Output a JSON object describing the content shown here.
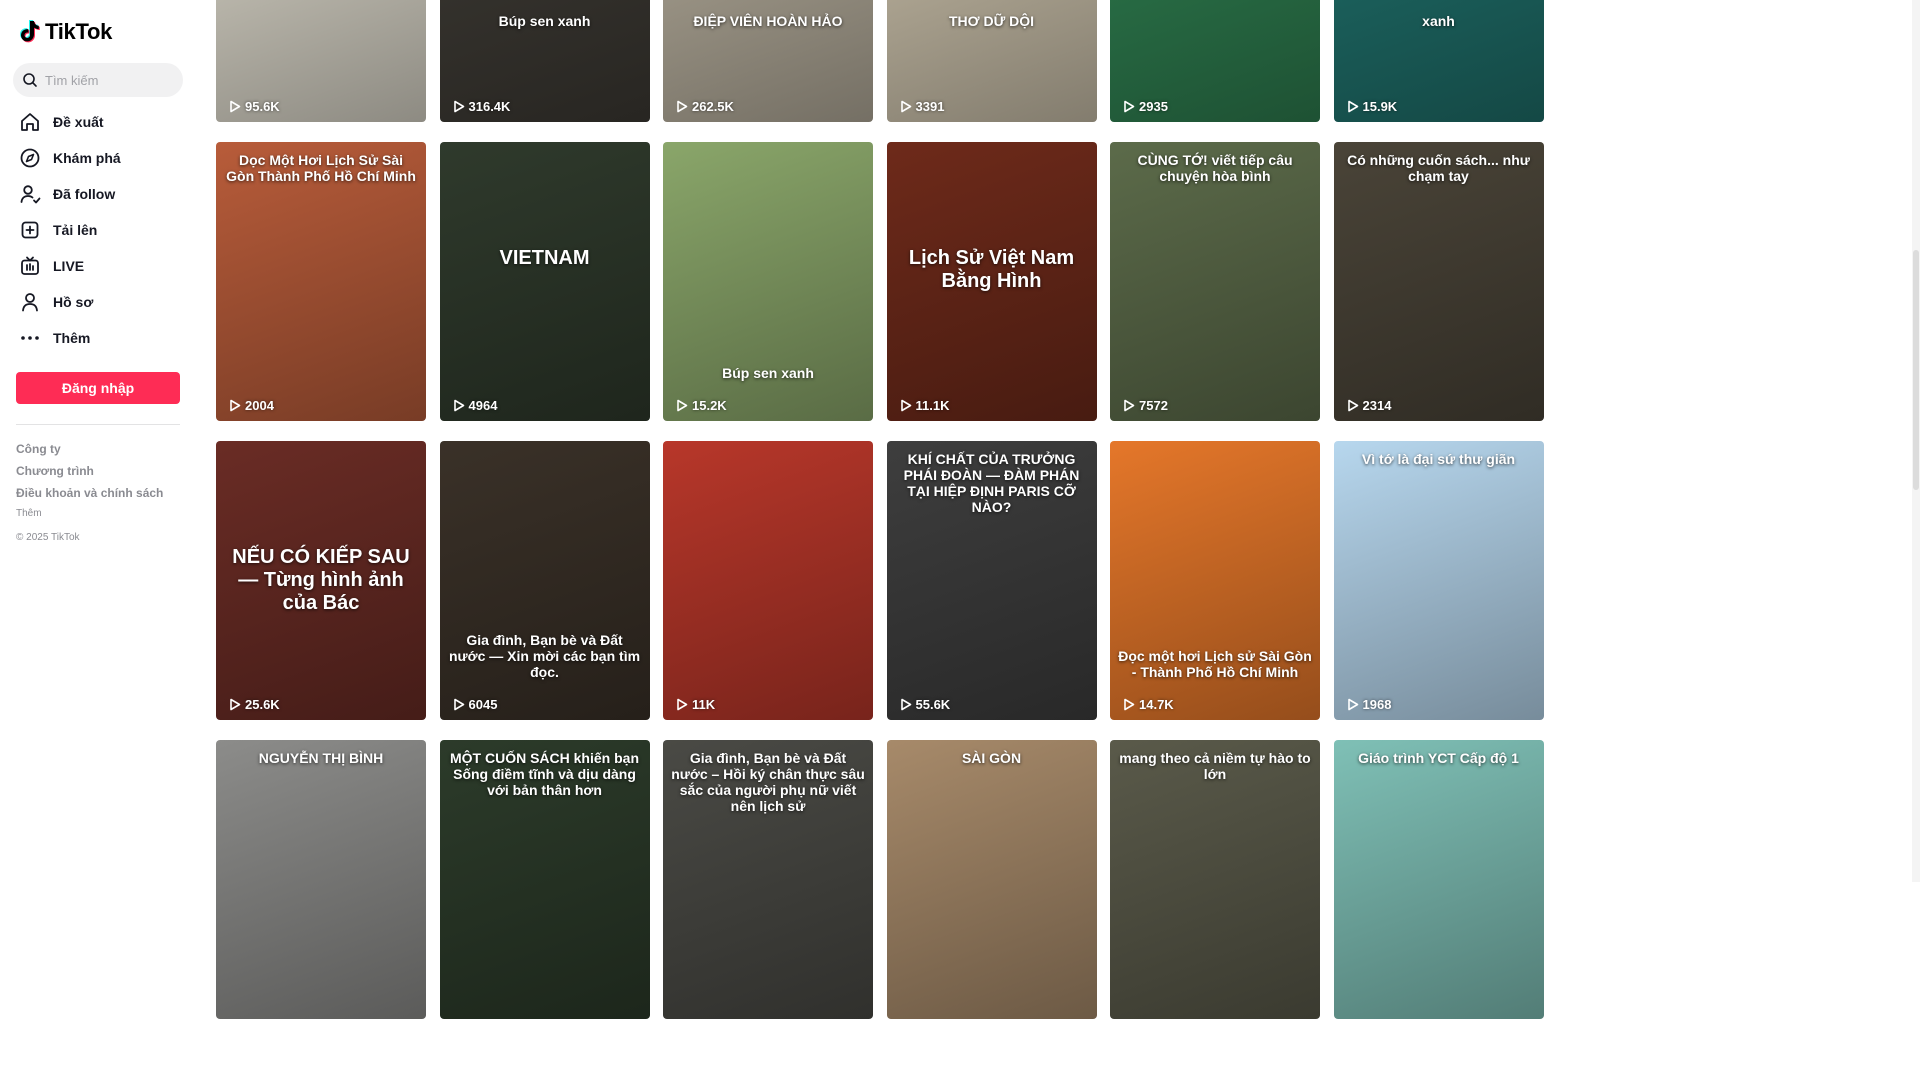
{
  "app": {
    "name": "TikTok"
  },
  "search": {
    "placeholder": "Tìm kiếm"
  },
  "nav": [
    {
      "label": "Đề xuất",
      "icon": "home-icon"
    },
    {
      "label": "Khám phá",
      "icon": "compass-icon"
    },
    {
      "label": "Đã follow",
      "icon": "following-icon"
    },
    {
      "label": "Tải lên",
      "icon": "upload-icon"
    },
    {
      "label": "LIVE",
      "icon": "live-icon"
    },
    {
      "label": "Hồ sơ",
      "icon": "profile-icon"
    },
    {
      "label": "Thêm",
      "icon": "more-icon"
    }
  ],
  "login_label": "Đăng nhập",
  "footer": {
    "links": [
      "Công ty",
      "Chương trình",
      "Điều khoản và chính sách"
    ],
    "more": "Thêm",
    "copyright": "© 2025 TikTok"
  },
  "videos": [
    {
      "views": "95.6K",
      "bg": "#d9d5c8",
      "caption": ""
    },
    {
      "views": "316.4K",
      "bg": "#3d3a34",
      "caption": "Búp sen xanh"
    },
    {
      "views": "262.5K",
      "bg": "#b3ab9a",
      "caption": "ĐIỆP VIÊN HOÀN HẢO"
    },
    {
      "views": "3391",
      "bg": "#c9bfa9",
      "caption": "THƠ DỮ DỘI"
    },
    {
      "views": "2935",
      "bg": "#2e7d4f",
      "caption": ""
    },
    {
      "views": "15.9K",
      "bg": "#1f6f6a",
      "caption": "xanh"
    },
    {
      "views": "2004",
      "bg": "#b85c3a",
      "caption": "Dọc Một Hơi Lịch Sử Sài Gòn Thành Phố Hồ Chí Minh"
    },
    {
      "views": "4964",
      "bg": "#2f3a2c",
      "caption": "VIETNAM"
    },
    {
      "views": "15.2K",
      "bg": "#8aa66a",
      "caption": "Búp sen xanh"
    },
    {
      "views": "11.1K",
      "bg": "#6e2a1a",
      "caption": "Lịch Sử Việt Nam Bằng Hình"
    },
    {
      "views": "7572",
      "bg": "#5c6b4a",
      "caption": "CÙNG TỚ! viết tiếp câu chuyện hòa bình"
    },
    {
      "views": "2314",
      "bg": "#4a4438",
      "caption": "Có những cuốn sách... như chạm tay"
    },
    {
      "views": "25.6K",
      "bg": "#6a2c25",
      "caption": "NẾU CÓ KIẾP SAU — Từng hình ảnh của Bác"
    },
    {
      "views": "6045",
      "bg": "#3a3128",
      "caption": "Gia đình, Bạn bè và Đất nước — Xin mời các bạn tìm đọc."
    },
    {
      "views": "11K",
      "bg": "#b8372a",
      "caption": ""
    },
    {
      "views": "55.6K",
      "bg": "#3e3e3e",
      "caption": "KHÍ CHẤT CỦA TRƯỞNG PHÁI ĐOÀN — ĐÀM PHÁN TẠI HIỆP ĐỊNH PARIS CỠ NÀO?"
    },
    {
      "views": "14.7K",
      "bg": "#e5772a",
      "caption": "Đọc một hơi Lịch sử Sài Gòn - Thành Phố Hồ Chí Minh"
    },
    {
      "views": "1968",
      "bg": "#b7d7ee",
      "caption": "Vì tớ là đại sứ thư giãn"
    },
    {
      "views": "",
      "bg": "#8c8c8a",
      "caption": "NGUYỄN THỊ BÌNH"
    },
    {
      "views": "",
      "bg": "#2c3b2a",
      "caption": "MỘT CUỐN SÁCH khiến bạn Sống điềm tĩnh và dịu dàng với bản thân hơn"
    },
    {
      "views": "",
      "bg": "#4a4a45",
      "caption": "Gia đình, Bạn bè và Đất nước – Hồi ký chân thực sâu sắc của người phụ nữ viết nên lịch sử"
    },
    {
      "views": "",
      "bg": "#a78a6a",
      "caption": "SÀI GÒN"
    },
    {
      "views": "",
      "bg": "#5a5a4a",
      "caption": "mang theo cả niềm tự hào to lớn"
    },
    {
      "views": "",
      "bg": "#7fc0b6",
      "caption": "Giáo trình YCT Cấp độ 1"
    }
  ]
}
